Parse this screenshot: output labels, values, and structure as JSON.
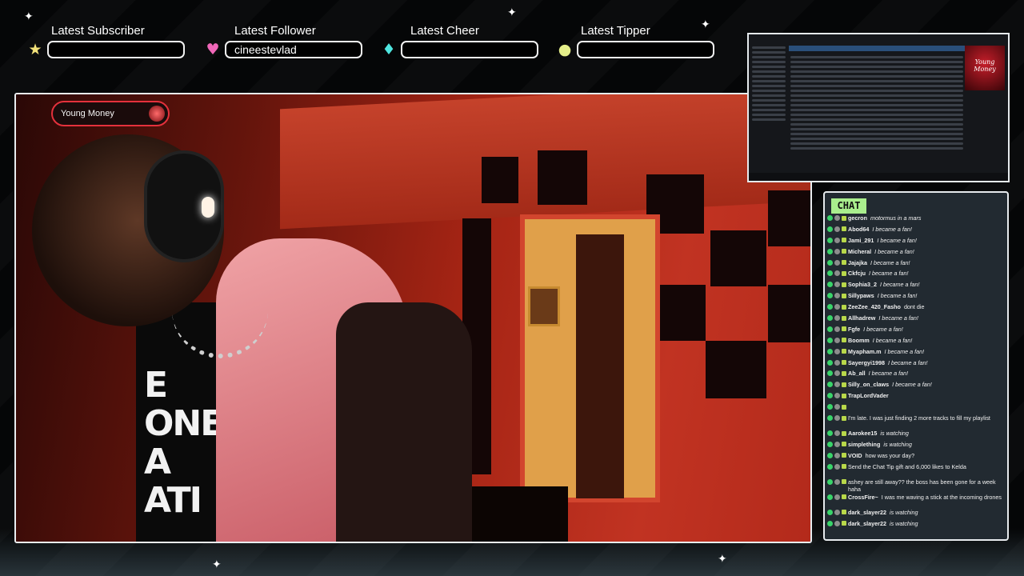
{
  "overlay": {
    "stats": [
      {
        "label": "Latest Subscriber",
        "value": "",
        "icon": "star-icon",
        "color": "#f3e27a"
      },
      {
        "label": "Latest Follower",
        "value": "cineestevlad",
        "icon": "heart-icon",
        "color": "#f067b8"
      },
      {
        "label": "Latest Cheer",
        "value": "",
        "icon": "gem-icon",
        "color": "#4fe6e0"
      },
      {
        "label": "Latest Tipper",
        "value": "",
        "icon": "coin-icon",
        "color": "#e5ef8a"
      }
    ]
  },
  "now_playing": {
    "label": "Young Money"
  },
  "screen_capture": {
    "album_text": "Young Money"
  },
  "chat": {
    "header": "CHAT",
    "messages": [
      {
        "user": "gecron",
        "text": "motormus in a mars"
      },
      {
        "user": "Abod64",
        "text": "I became a fan!"
      },
      {
        "user": "Jami_291",
        "text": "I became a fan!"
      },
      {
        "user": "Micheral",
        "text": "I became a fan!"
      },
      {
        "user": "Jajajka",
        "text": "I became a fan!"
      },
      {
        "user": "Ckfcju",
        "text": "I became a fan!"
      },
      {
        "user": "Sophia3_2",
        "text": "I became a fan!"
      },
      {
        "user": "Sillypaws",
        "text": "I became a fan!"
      },
      {
        "user": "ZeeZee_420_Fasho",
        "text": "dont die",
        "plain": true
      },
      {
        "user": "Allhadrew",
        "text": "I became a fan!"
      },
      {
        "user": "Fgfe",
        "text": "I became a fan!"
      },
      {
        "user": "Boomm",
        "text": "I became a fan!"
      },
      {
        "user": "Myapham.m",
        "text": "I became a fan!"
      },
      {
        "user": "Sayergyi1998",
        "text": "I became a fan!"
      },
      {
        "user": "Ab_all",
        "text": "I became a fan!"
      },
      {
        "user": "Silly_on_claws",
        "text": "I became a fan!"
      },
      {
        "user": "TrapLordVader",
        "text": "",
        "plain": true
      },
      {
        "user": "",
        "text": "",
        "plain": true
      },
      {
        "user": "",
        "text": "I'm late. I was just finding 2 more tracks to fill my playlist",
        "plain": true,
        "tall": true
      },
      {
        "user": "Aarokee15",
        "text": "is watching"
      },
      {
        "user": "simplething",
        "text": "is watching"
      },
      {
        "user": "VOID",
        "text": "how was your day?",
        "plain": true
      },
      {
        "user": "",
        "text": "Send the Chat Tip gift and 6,000 likes to Kelda",
        "plain": true,
        "tall": true
      },
      {
        "user": "",
        "text": "ashey are still away?? the boss has been gone for a week haha",
        "plain": true,
        "tall": true
      },
      {
        "user": "CrossFire~",
        "text": "I was me waving a stick at the incoming drones",
        "plain": true,
        "tall": true
      },
      {
        "user": "dark_slayer22",
        "text": "is watching"
      },
      {
        "user": "dark_slayer22",
        "text": "is watching"
      }
    ]
  }
}
